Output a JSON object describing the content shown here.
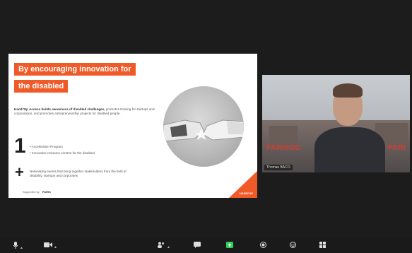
{
  "slide": {
    "title_line1": "By encouraging innovation for",
    "title_line2": "the disabled",
    "intro_bold": "Handi'Up Access builds awareness of disabled challenges,",
    "intro_rest": "promotes training for startups and corporations, and promotes entrepreneurship projects for disabled people.",
    "big_number": "1",
    "bullets": [
      "• Acceleration Program",
      "• Innovative resource centers for the disabled"
    ],
    "big_plus": "+",
    "plus_text": "Networking events that bring together stakeholders from the field of disability, startups and corporates",
    "supported_by": "Supported by",
    "supporter_logo": "PARIS",
    "corner_logo": "HANDI'UP"
  },
  "video": {
    "participant_name": "Thomas BACO",
    "neon_left": "PARISOO",
    "neon_right": "PARI"
  },
  "toolbar": {
    "icons": [
      "mic-icon",
      "video-icon",
      "participants-icon",
      "chat-icon",
      "share-screen-icon",
      "record-icon",
      "reactions-icon",
      "apps-icon"
    ]
  },
  "colors": {
    "accent": "#f05a28",
    "share_green": "#2fd05a"
  }
}
